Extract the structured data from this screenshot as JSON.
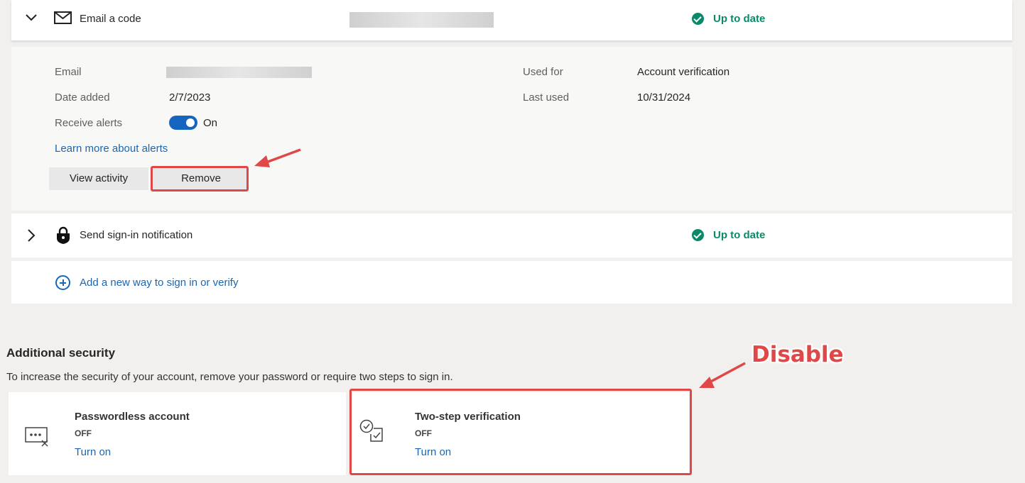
{
  "email_method": {
    "title": "Email a code",
    "status": "Up to date",
    "details": {
      "email_label": "Email",
      "date_added_label": "Date added",
      "date_added": "2/7/2023",
      "receive_alerts_label": "Receive alerts",
      "toggle_state": "On",
      "used_for_label": "Used for",
      "used_for": "Account verification",
      "last_used_label": "Last used",
      "last_used": "10/31/2024",
      "learn_more_link": "Learn more about alerts",
      "view_activity_button": "View activity",
      "remove_button": "Remove"
    }
  },
  "notification_method": {
    "title": "Send sign-in notification",
    "status": "Up to date"
  },
  "add_method": {
    "label": "Add a new way to sign in or verify"
  },
  "additional_security": {
    "title": "Additional security",
    "description": "To increase the security of your account, remove your password or require two steps to sign in.",
    "cards": [
      {
        "name": "Passwordless account",
        "state": "OFF",
        "action": "Turn on",
        "icon": "passwordless-icon"
      },
      {
        "name": "Two-step verification",
        "state": "OFF",
        "action": "Turn on",
        "icon": "two-step-icon"
      }
    ]
  },
  "annotation": {
    "text": "Disable",
    "color": "#e04848"
  },
  "colors": {
    "status_green": "#0b8a6a",
    "link_blue": "#1a66b3",
    "toggle_blue": "#1464c0"
  }
}
